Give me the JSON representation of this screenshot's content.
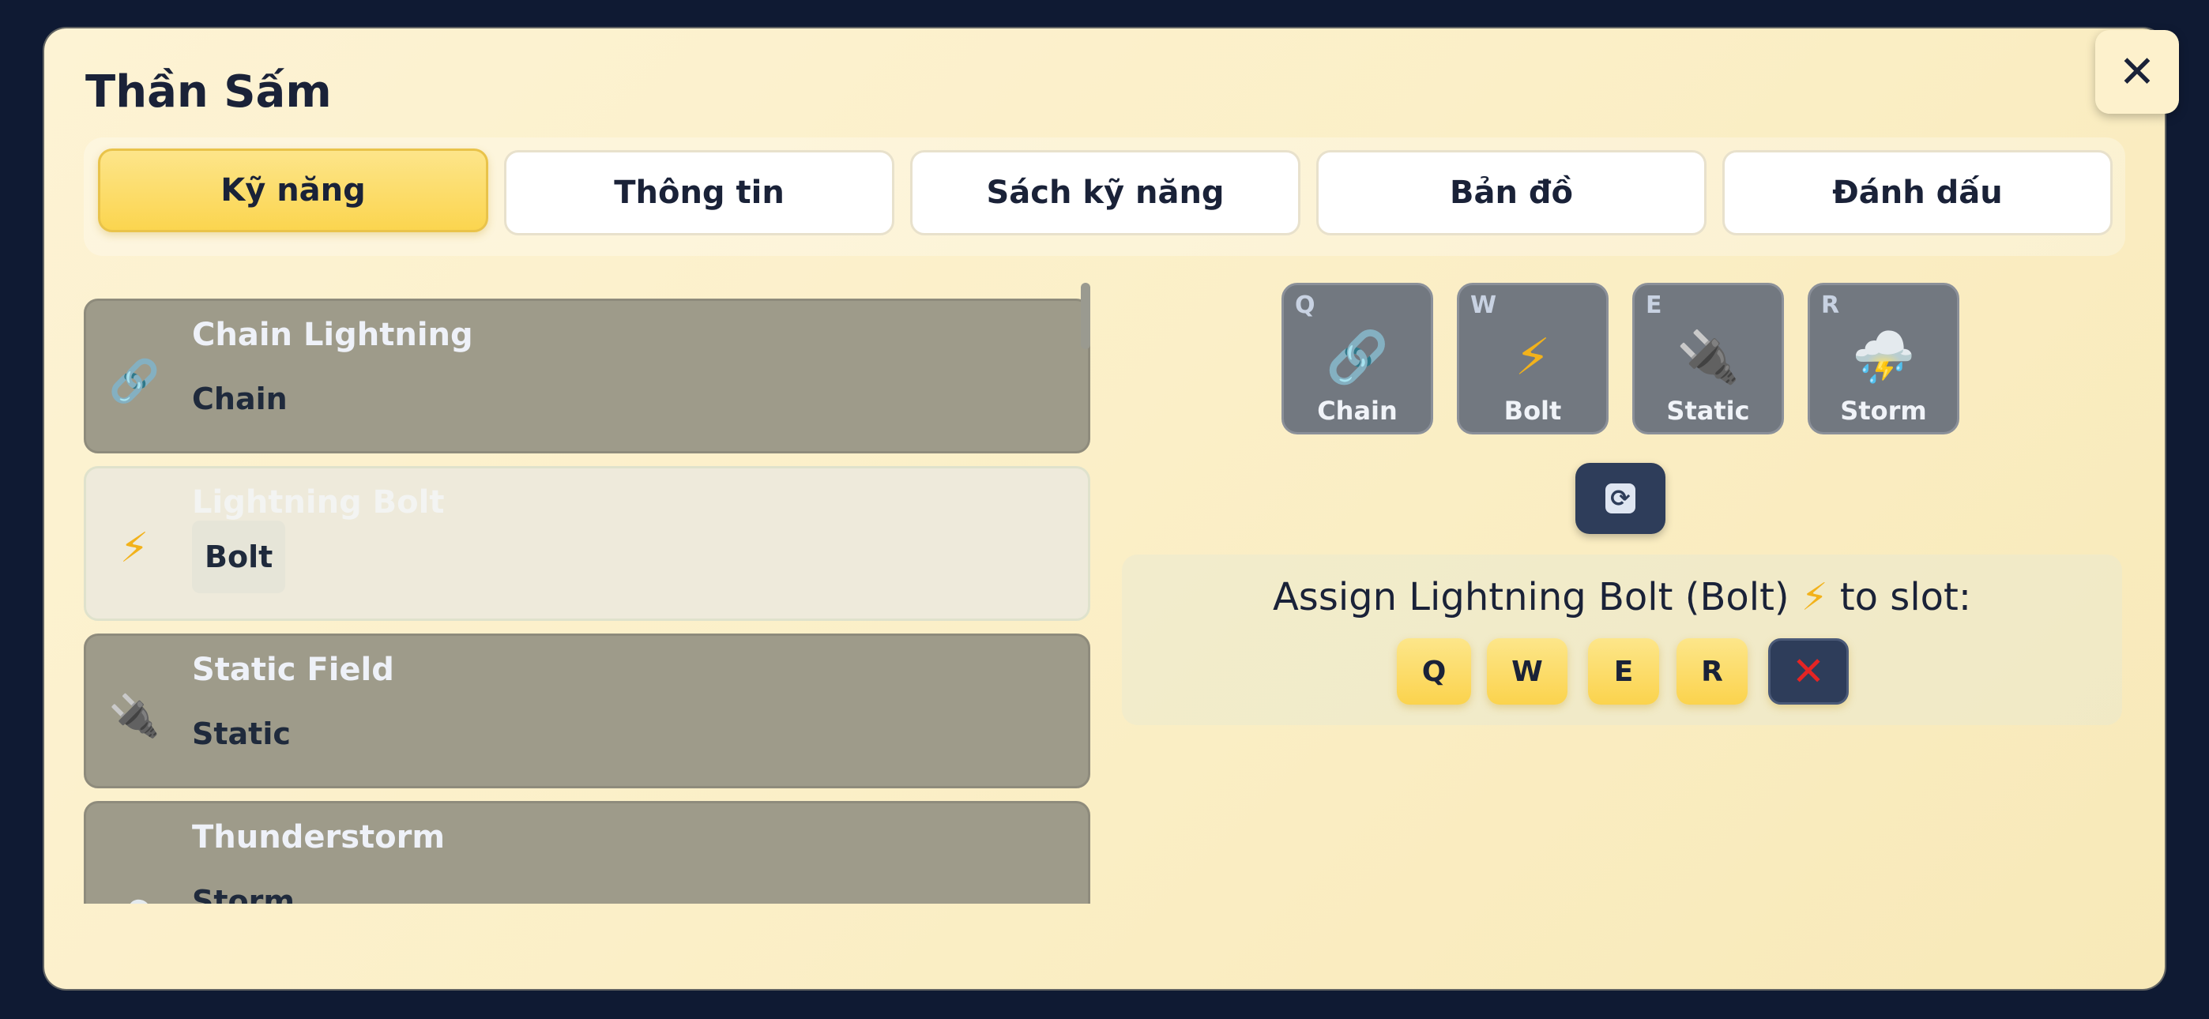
{
  "dialog": {
    "title": "Thần Sấm",
    "close_icon": "✕"
  },
  "tabs": [
    {
      "label": "Kỹ năng",
      "active": true
    },
    {
      "label": "Thông tin",
      "active": false
    },
    {
      "label": "Sách kỹ năng",
      "active": false
    },
    {
      "label": "Bản đồ",
      "active": false
    },
    {
      "label": "Đánh dấu",
      "active": false
    }
  ],
  "skills": [
    {
      "name": "Chain Lightning",
      "short": "Chain",
      "icon": "🔗",
      "icon_name": "link-icon",
      "selected": false
    },
    {
      "name": "Lightning Bolt",
      "short": "Bolt",
      "icon": "⚡",
      "icon_name": "lightning-bolt-icon",
      "selected": true
    },
    {
      "name": "Static Field",
      "short": "Static",
      "icon": "🔌",
      "icon_name": "electric-plug-icon",
      "selected": false
    },
    {
      "name": "Thunderstorm",
      "short": "Storm",
      "icon": "⛈️",
      "icon_name": "thunderstorm-icon",
      "selected": false
    }
  ],
  "slots": [
    {
      "key": "Q",
      "icon": "🔗",
      "icon_name": "link-icon",
      "label": "Chain"
    },
    {
      "key": "W",
      "icon": "⚡",
      "icon_name": "lightning-bolt-icon",
      "label": "Bolt"
    },
    {
      "key": "E",
      "icon": "🔌",
      "icon_name": "electric-plug-icon",
      "label": "Static"
    },
    {
      "key": "R",
      "icon": "⛈️",
      "icon_name": "thunderstorm-icon",
      "label": "Storm"
    }
  ],
  "refresh_icon": "⟳",
  "assign": {
    "prefix": "Assign Lightning Bolt (Bolt)",
    "icon": "⚡",
    "suffix": "to slot:",
    "buttons": [
      "Q",
      "W",
      "E",
      "R"
    ],
    "clear_icon": "✕",
    "clear_color": "#e52424"
  },
  "colors": {
    "accent": "#fbd54f",
    "panel": "#fbefc7",
    "dark": "#2e3d5a"
  }
}
